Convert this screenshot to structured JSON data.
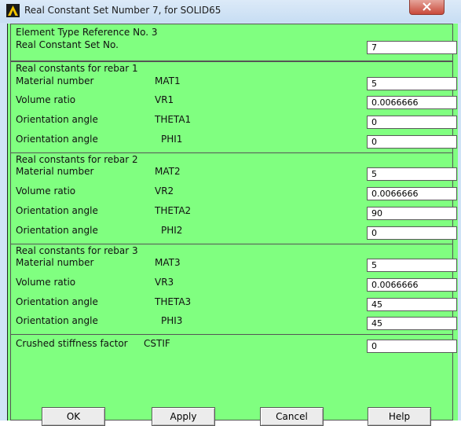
{
  "window": {
    "title": "Real Constant Set Number 7, for SOLID65",
    "close_icon": "close-x-icon",
    "app_icon": "ansys-logo-icon"
  },
  "header": {
    "element_type_ref": "Element Type Reference No. 3",
    "set_no_label": "Real Constant Set No.",
    "set_no_value": "7"
  },
  "rebar1": {
    "title": "Real constants for rebar 1",
    "rows": [
      {
        "label": "Material number",
        "key": "MAT1",
        "value": "5"
      },
      {
        "label": "Volume ratio",
        "key": "VR1",
        "value": "0.0066666"
      },
      {
        "label": "Orientation angle",
        "key": "THETA1",
        "value": "0"
      },
      {
        "label": "Orientation angle",
        "key": "PHI1",
        "value": "0"
      }
    ]
  },
  "rebar2": {
    "title": "Real constants for rebar 2",
    "rows": [
      {
        "label": "Material number",
        "key": "MAT2",
        "value": "5"
      },
      {
        "label": "Volume ratio",
        "key": "VR2",
        "value": "0.0066666"
      },
      {
        "label": "Orientation angle",
        "key": "THETA2",
        "value": "90"
      },
      {
        "label": "Orientation angle",
        "key": "PHI2",
        "value": "0"
      }
    ]
  },
  "rebar3": {
    "title": "Real constants for rebar 3",
    "rows": [
      {
        "label": "Material number",
        "key": "MAT3",
        "value": "5"
      },
      {
        "label": "Volume ratio",
        "key": "VR3",
        "value": "0.0066666"
      },
      {
        "label": "Orientation angle",
        "key": "THETA3",
        "value": "45"
      },
      {
        "label": "Orientation angle",
        "key": "PHI3",
        "value": "45"
      }
    ]
  },
  "crush": {
    "label": "Crushed stiffness factor",
    "key": "CSTIF",
    "value": "0"
  },
  "buttons": {
    "ok": "OK",
    "apply": "Apply",
    "cancel": "Cancel",
    "help": "Help"
  },
  "colors": {
    "dialog_background": "#80ff80",
    "titlebar": "#cfe3f6",
    "close_button": "#c9493a"
  }
}
